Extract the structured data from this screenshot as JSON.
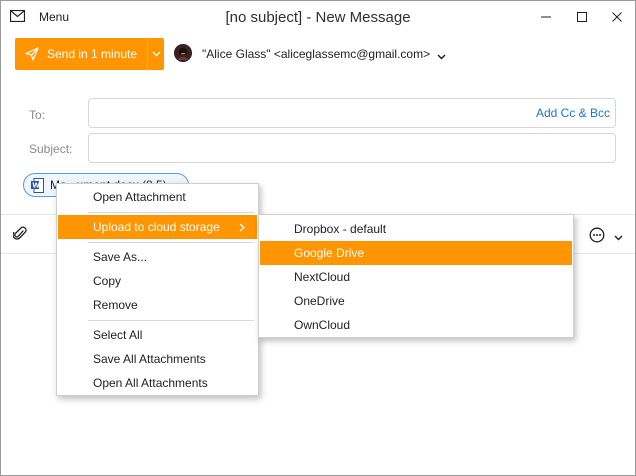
{
  "window": {
    "menu_label": "Menu",
    "title": "[no subject] - New Message"
  },
  "toolbar": {
    "send_label": "Send in 1 minute",
    "from": "\"Alice Glass\" <aliceglassemc@gmail.com>"
  },
  "fields": {
    "to_label": "To:",
    "add_cc_label": "Add Cc & Bcc",
    "subject_label": "Subject:",
    "to_value": "",
    "subject_value": ""
  },
  "attachment": {
    "name": "Ma...ument.docx (8.5)"
  },
  "context_menu": {
    "items": [
      {
        "label": "Open Attachment"
      },
      {
        "label": "Upload to cloud storage",
        "has_submenu": true
      },
      {
        "label": "Save As..."
      },
      {
        "label": "Copy"
      },
      {
        "label": "Remove"
      },
      {
        "label": "Select All"
      },
      {
        "label": "Save All Attachments"
      },
      {
        "label": "Open All Attachments"
      }
    ],
    "active_index": 1
  },
  "submenu": {
    "items": [
      {
        "label": "Dropbox - default"
      },
      {
        "label": "Google Drive"
      },
      {
        "label": "NextCloud"
      },
      {
        "label": "OneDrive"
      },
      {
        "label": "OwnCloud"
      }
    ],
    "active_index": 1
  },
  "colors": {
    "accent": "#ff9500",
    "link": "#1a73d9",
    "chip_border": "#5a9ad8"
  },
  "icons": {
    "menu": "envelope-icon",
    "send": "paper-plane-icon",
    "attach": "paperclip-icon",
    "more": "ellipsis-circle-icon",
    "file": "word-document-icon"
  }
}
